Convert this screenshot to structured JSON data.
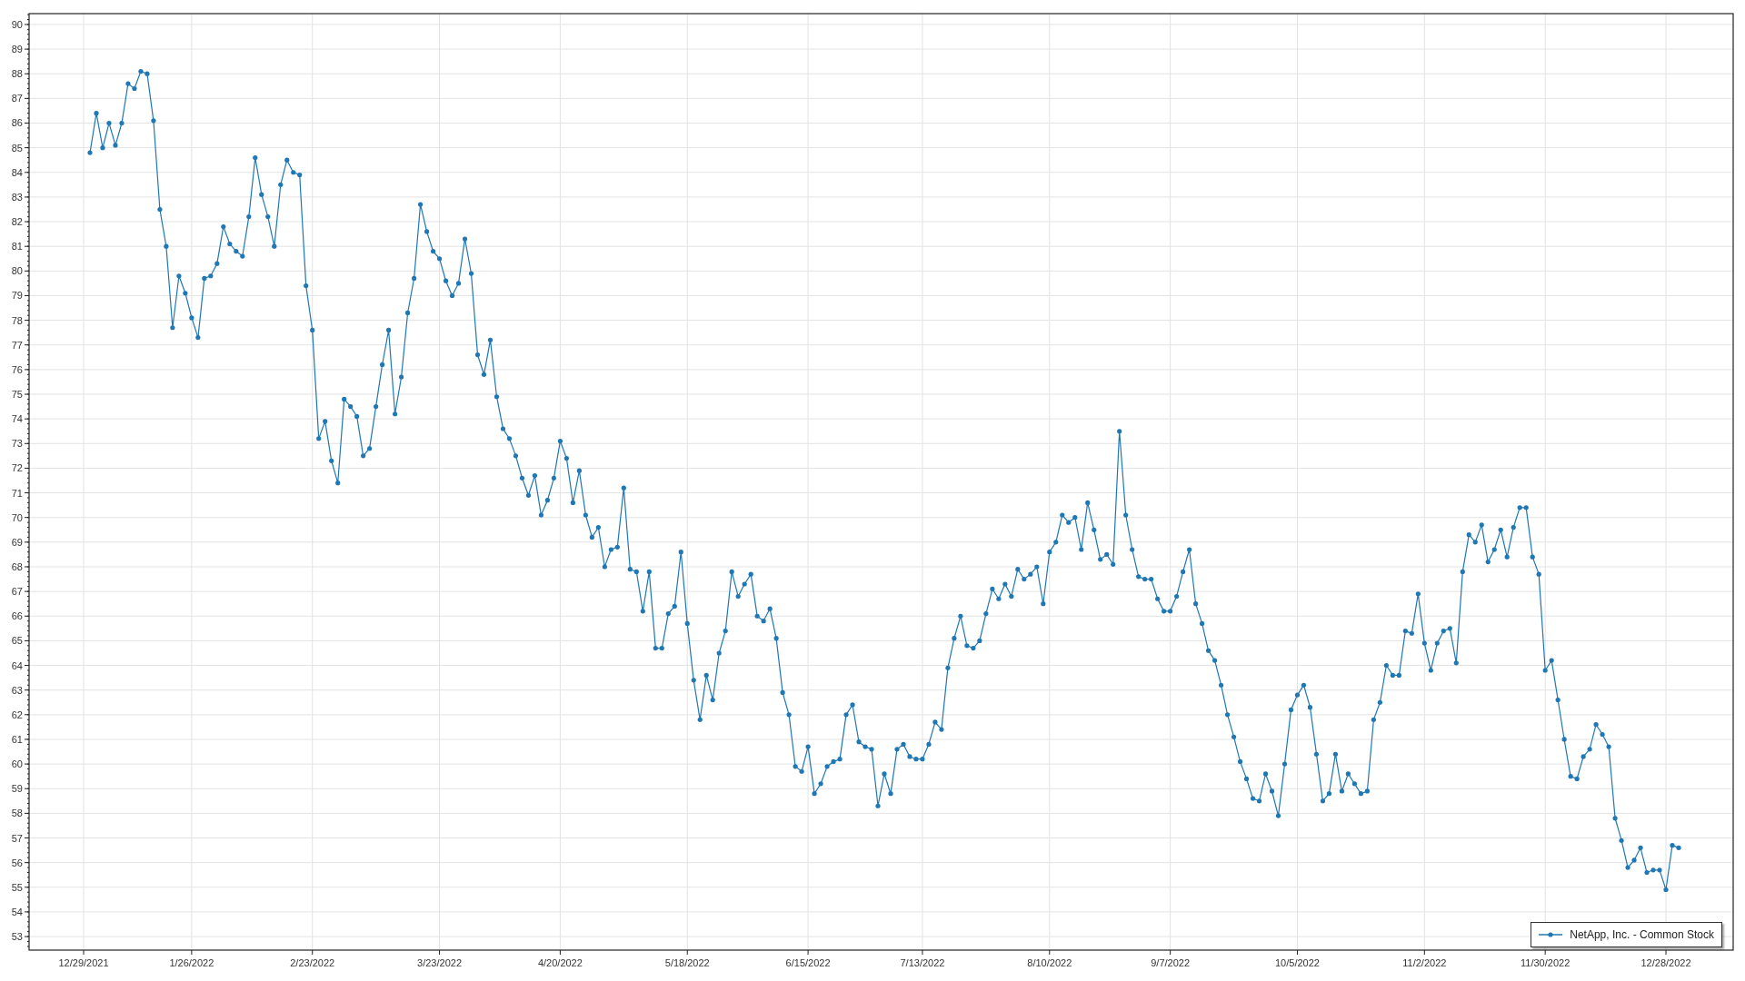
{
  "chart": {
    "chart_data": {
      "type": "line",
      "grid": true,
      "ylim": [
        52.45,
        90.44
      ],
      "categories": [
        "12/29/2021",
        null,
        null,
        null,
        null,
        null,
        null,
        null,
        null,
        null,
        null,
        null,
        null,
        null,
        null,
        null,
        null,
        "1/26/2022",
        null,
        null,
        null,
        null,
        null,
        null,
        null,
        null,
        null,
        null,
        null,
        null,
        null,
        null,
        null,
        null,
        null,
        null,
        "2/23/2022",
        null,
        null,
        null,
        null,
        null,
        null,
        null,
        null,
        null,
        null,
        null,
        null,
        null,
        null,
        null,
        null,
        null,
        null,
        null,
        "3/23/2022",
        null,
        null,
        null,
        null,
        null,
        null,
        null,
        null,
        null,
        null,
        null,
        null,
        null,
        null,
        null,
        null,
        null,
        null,
        "4/20/2022",
        null,
        null,
        null,
        null,
        null,
        null,
        null,
        null,
        null,
        null,
        null,
        null,
        null,
        null,
        null,
        null,
        null,
        null,
        null,
        "5/18/2022",
        null,
        null,
        null,
        null,
        null,
        null,
        null,
        null,
        null,
        null,
        null,
        null,
        null,
        null,
        null,
        null,
        null,
        null,
        "6/15/2022",
        null,
        null,
        null,
        null,
        null,
        null,
        null,
        null,
        null,
        null,
        null,
        null,
        null,
        null,
        null,
        null,
        null,
        "7/13/2022",
        null,
        null,
        null,
        null,
        null,
        null,
        null,
        null,
        null,
        null,
        null,
        null,
        null,
        null,
        null,
        null,
        null,
        null,
        null,
        "8/10/2022",
        null,
        null,
        null,
        null,
        null,
        null,
        null,
        null,
        null,
        null,
        null,
        null,
        null,
        null,
        null,
        null,
        null,
        null,
        "9/7/2022",
        null,
        null,
        null,
        null,
        null,
        null,
        null,
        null,
        null,
        null,
        null,
        null,
        null,
        null,
        null,
        null,
        null,
        null,
        null,
        "10/5/2022",
        null,
        null,
        null,
        null,
        null,
        null,
        null,
        null,
        null,
        null,
        null,
        null,
        null,
        null,
        null,
        null,
        null,
        null,
        null,
        "11/2/2022",
        null,
        null,
        null,
        null,
        null,
        null,
        null,
        null,
        null,
        null,
        null,
        null,
        null,
        null,
        null,
        null,
        null,
        null,
        "11/30/2022",
        null,
        null,
        null,
        null,
        null,
        null,
        null,
        null,
        null,
        null,
        null,
        null,
        null,
        null,
        null,
        null,
        null,
        null,
        "12/28/2022",
        null,
        null
      ],
      "yticks": [
        53,
        54,
        55,
        56,
        57,
        58,
        59,
        60,
        61,
        62,
        63,
        64,
        65,
        66,
        67,
        68,
        69,
        70,
        71,
        72,
        73,
        74,
        75,
        76,
        77,
        78,
        79,
        80,
        81,
        82,
        83,
        84,
        85,
        86,
        87,
        88,
        89,
        90
      ],
      "series": [
        {
          "name": "NetApp, Inc. - Common Stock",
          "color": "#1f77b4",
          "values": [
            null,
            84.8,
            86.4,
            85.0,
            86.0,
            85.1,
            86.0,
            87.6,
            87.4,
            88.1,
            88.0,
            86.1,
            82.5,
            81.0,
            77.7,
            79.8,
            79.1,
            78.1,
            77.3,
            79.7,
            79.8,
            80.3,
            81.8,
            81.1,
            80.8,
            80.6,
            82.2,
            84.6,
            83.1,
            82.2,
            81.0,
            83.5,
            84.5,
            84.0,
            83.9,
            79.4,
            77.6,
            73.2,
            73.9,
            72.3,
            71.4,
            74.8,
            74.5,
            74.1,
            72.5,
            72.8,
            74.5,
            76.2,
            77.6,
            74.2,
            75.7,
            78.3,
            79.7,
            82.7,
            81.6,
            80.8,
            80.5,
            79.6,
            79.0,
            79.5,
            81.3,
            79.9,
            76.6,
            75.8,
            77.2,
            74.9,
            73.6,
            73.2,
            72.5,
            71.6,
            70.9,
            71.7,
            70.1,
            70.7,
            71.6,
            73.1,
            72.4,
            70.6,
            71.9,
            70.1,
            69.2,
            69.6,
            68.0,
            68.7,
            68.8,
            71.2,
            67.9,
            67.8,
            66.2,
            67.8,
            64.7,
            64.7,
            66.1,
            66.4,
            68.6,
            65.7,
            63.4,
            61.8,
            63.6,
            62.6,
            64.5,
            65.4,
            67.8,
            66.8,
            67.3,
            67.7,
            66.0,
            65.8,
            66.3,
            65.1,
            62.9,
            62.0,
            59.9,
            59.7,
            60.7,
            58.8,
            59.2,
            59.9,
            60.1,
            60.2,
            62.0,
            62.4,
            60.9,
            60.7,
            60.6,
            58.3,
            59.6,
            58.8,
            60.6,
            60.8,
            60.3,
            60.2,
            60.2,
            60.8,
            61.7,
            61.4,
            63.9,
            65.1,
            66.0,
            64.8,
            64.7,
            65.0,
            66.1,
            67.1,
            66.7,
            67.3,
            66.8,
            67.9,
            67.5,
            67.7,
            68.0,
            66.5,
            68.6,
            69.0,
            70.1,
            69.8,
            70.0,
            68.7,
            70.6,
            69.5,
            68.3,
            68.5,
            68.1,
            73.5,
            70.1,
            68.7,
            67.6,
            67.5,
            67.5,
            66.7,
            66.2,
            66.2,
            66.8,
            67.8,
            68.7,
            66.5,
            65.7,
            64.6,
            64.2,
            63.2,
            62.0,
            61.1,
            60.1,
            59.4,
            58.6,
            58.5,
            59.6,
            58.9,
            57.9,
            60.0,
            62.2,
            62.8,
            63.2,
            62.3,
            60.4,
            58.5,
            58.8,
            60.4,
            58.9,
            59.6,
            59.2,
            58.8,
            58.9,
            61.8,
            62.5,
            64.0,
            63.6,
            63.6,
            65.4,
            65.3,
            66.9,
            64.9,
            63.8,
            64.9,
            65.4,
            65.5,
            64.1,
            67.8,
            69.3,
            69.0,
            69.7,
            68.2,
            68.7,
            69.5,
            68.4,
            69.6,
            70.4,
            70.4,
            68.4,
            67.7,
            63.8,
            64.2,
            62.6,
            61.0,
            59.5,
            59.4,
            60.3,
            60.6,
            61.6,
            61.2,
            60.7,
            57.8,
            56.9,
            55.8,
            56.1,
            56.6,
            55.6,
            55.7,
            55.7,
            54.9,
            56.7,
            56.6
          ]
        }
      ]
    }
  }
}
